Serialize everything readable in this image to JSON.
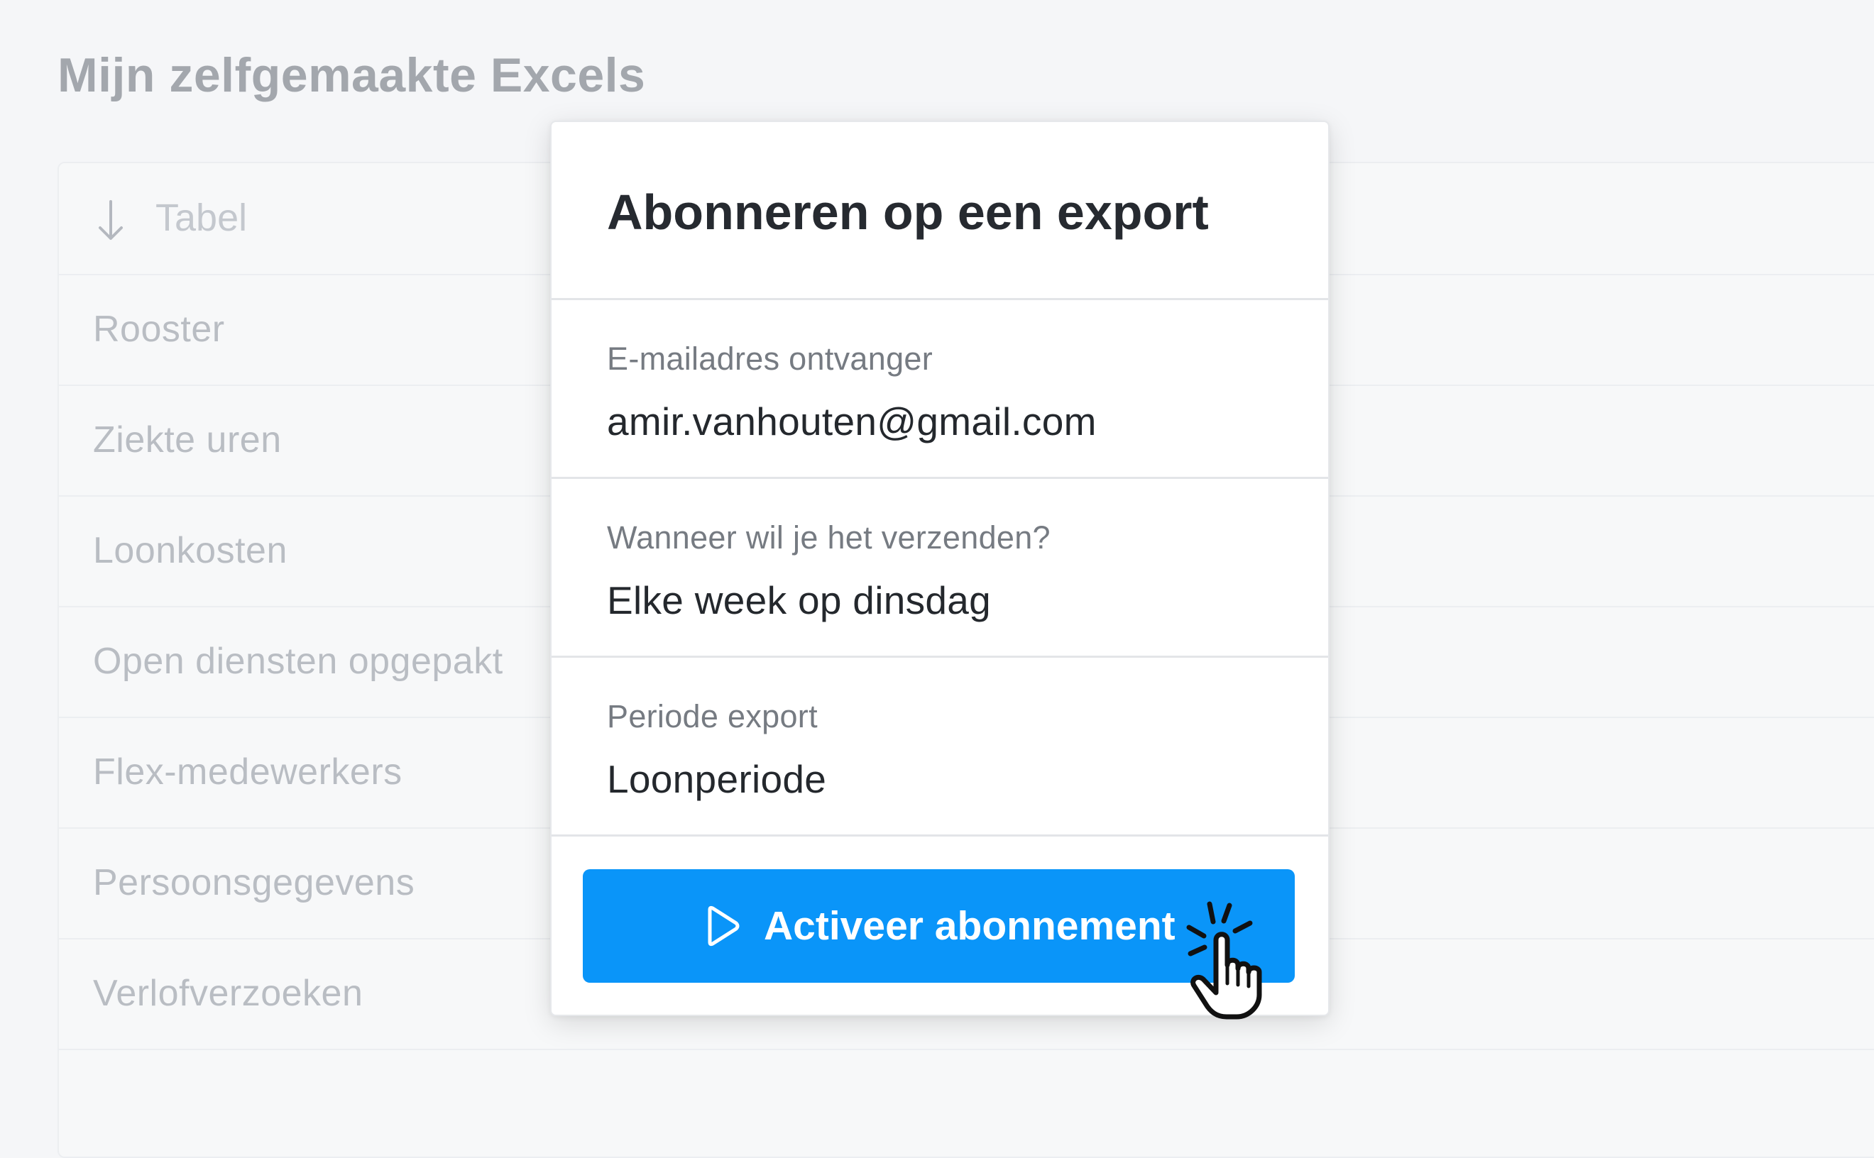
{
  "page": {
    "title": "Mijn zelfgemaakte Excels"
  },
  "table": {
    "header": {
      "sort_icon": "arrow-down-icon",
      "label": "Tabel"
    },
    "rows": [
      "Rooster",
      "Ziekte uren",
      "Loonkosten",
      "Open diensten opgepakt",
      "Flex-medewerkers",
      "Persoonsgegevens",
      "Verlofverzoeken"
    ]
  },
  "modal": {
    "title": "Abonneren op een export",
    "fields": [
      {
        "label": "E-mailadres ontvanger",
        "value": "amir.vanhouten@gmail.com"
      },
      {
        "label": "Wanneer wil je het verzenden?",
        "value": "Elke week op dinsdag"
      },
      {
        "label": "Periode export",
        "value": "Loonperiode"
      }
    ],
    "button": {
      "label": "Activeer abonnement",
      "icon": "play-icon"
    }
  },
  "colors": {
    "accent": "#0a95f9",
    "background": "#f5f6f8"
  }
}
